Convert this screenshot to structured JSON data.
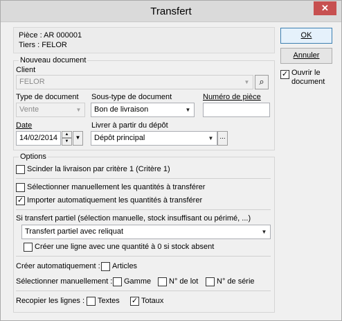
{
  "window": {
    "title": "Transfert",
    "close_glyph": "✕"
  },
  "info": {
    "piece": "Pièce : AR 000001",
    "tiers": "Tiers : FELOR"
  },
  "buttons": {
    "ok": "OK",
    "cancel": "Annuler"
  },
  "open_doc": {
    "label_line1": "Ouvrir le",
    "label_line2": "document",
    "checked": true
  },
  "nouveau": {
    "legend": "Nouveau document",
    "client_label": "Client",
    "client_value": "FELOR",
    "type_label": "Type de document",
    "type_value": "Vente",
    "subtype_label": "Sous-type de document",
    "subtype_value": "Bon de livraison",
    "numero_label": "Numéro de pièce",
    "numero_value": "",
    "date_label": "Date",
    "date_value": "14/02/2014",
    "depot_label": "Livrer à partir du dépôt",
    "depot_value": "Dépôt principal"
  },
  "options": {
    "legend": "Options",
    "scinder": {
      "label": "Scinder la livraison par critère 1 (Critère 1)",
      "checked": false
    },
    "select_manual": {
      "label": "Sélectionner manuellement les quantités à transférer",
      "checked": false
    },
    "import_auto": {
      "label": "Importer automatiquement les quantités à transférer",
      "checked": true
    },
    "partial_label": "Si transfert partiel (sélection manuelle, stock insuffisant ou périmé, ...)",
    "partial_value": "Transfert partiel avec reliquat",
    "zero_line": {
      "label": "Créer une ligne avec une quantité à 0 si stock absent",
      "checked": false
    },
    "create_auto_label": "Créer automatiquement :",
    "articles": {
      "label": "Articles",
      "checked": false
    },
    "select_manual2_label": "Sélectionner manuellement :",
    "gamme": {
      "label": "Gamme",
      "checked": false
    },
    "lot": {
      "label": "N° de lot",
      "checked": false
    },
    "serie": {
      "label": "N° de série",
      "checked": false
    },
    "recopier_label": "Recopier les lignes :",
    "textes": {
      "label": "Textes",
      "checked": false
    },
    "totaux": {
      "label": "Totaux",
      "checked": true
    }
  },
  "glyphs": {
    "check": "✓",
    "down": "▼",
    "up": "▲",
    "ellipsis": "...",
    "binoculars": "⌕"
  }
}
